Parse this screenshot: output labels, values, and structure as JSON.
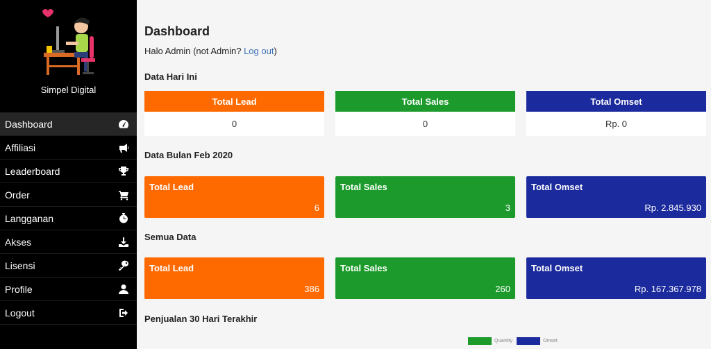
{
  "sidebar": {
    "site_name": "Simpel Digital",
    "items": [
      {
        "label": "Dashboard",
        "icon": "dashboard-icon",
        "active": true
      },
      {
        "label": "Affiliasi",
        "icon": "megaphone-icon"
      },
      {
        "label": "Leaderboard",
        "icon": "trophy-icon"
      },
      {
        "label": "Order",
        "icon": "cart-icon"
      },
      {
        "label": "Langganan",
        "icon": "stopwatch-icon"
      },
      {
        "label": "Akses",
        "icon": "download-icon"
      },
      {
        "label": "Lisensi",
        "icon": "key-icon"
      },
      {
        "label": "Profile",
        "icon": "user-icon"
      },
      {
        "label": "Logout",
        "icon": "logout-icon"
      }
    ]
  },
  "main": {
    "title": "Dashboard",
    "greeting_prefix": "Halo Admin (not Admin? ",
    "logout_link": "Log out",
    "greeting_suffix": ")",
    "today": {
      "title": "Data Hari Ini",
      "lead_label": "Total Lead",
      "lead_value": "0",
      "sales_label": "Total Sales",
      "sales_value": "0",
      "omset_label": "Total Omset",
      "omset_value": "Rp. 0"
    },
    "month": {
      "title": "Data Bulan Feb 2020",
      "lead_label": "Total Lead",
      "lead_value": "6",
      "sales_label": "Total Sales",
      "sales_value": "3",
      "omset_label": "Total Omset",
      "omset_value": "Rp. 2.845.930"
    },
    "all": {
      "title": "Semua Data",
      "lead_label": "Total Lead",
      "lead_value": "386",
      "sales_label": "Total Sales",
      "sales_value": "260",
      "omset_label": "Total Omset",
      "omset_value": "Rp. 167.367.978"
    },
    "chart_section_title": "Penjualan 30 Hari Terakhir",
    "legend": {
      "quantity": "Quantity",
      "omset": "Omset"
    }
  },
  "colors": {
    "orange": "#ff6a00",
    "green": "#1c9b2c",
    "blue": "#1b2a9c"
  }
}
